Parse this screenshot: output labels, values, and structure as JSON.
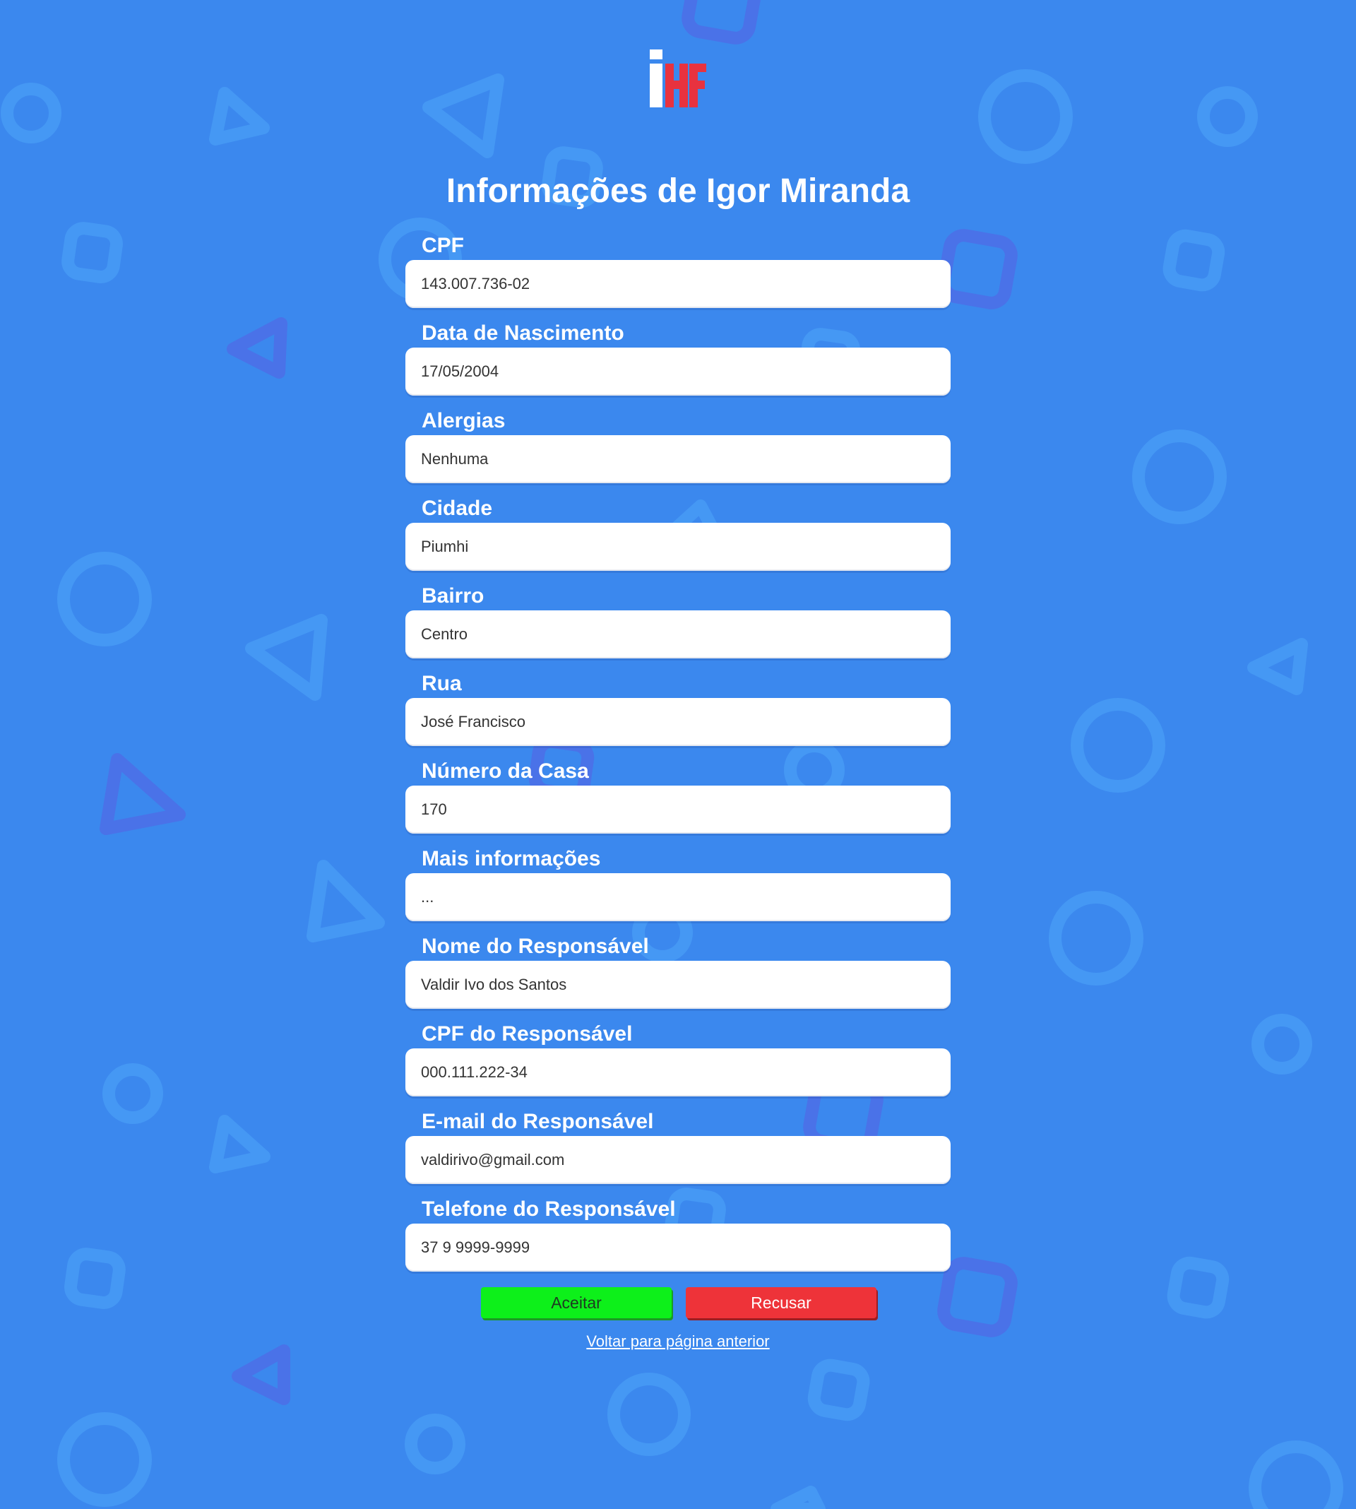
{
  "colors": {
    "background": "#3B88EE",
    "decoration": "#4598F4",
    "decoration_alt": "#4A72E8",
    "accept": "#0DF01A",
    "reject": "#EE3339",
    "logo_white": "#FFFFFF",
    "logo_red": "#E8323F"
  },
  "logo": {
    "letters": "iHF"
  },
  "page": {
    "title": "Informações de Igor Miranda"
  },
  "fields": [
    {
      "label": "CPF",
      "value": "143.007.736-02"
    },
    {
      "label": "Data de Nascimento",
      "value": "17/05/2004"
    },
    {
      "label": "Alergias",
      "value": "Nenhuma"
    },
    {
      "label": "Cidade",
      "value": "Piumhi"
    },
    {
      "label": "Bairro",
      "value": "Centro"
    },
    {
      "label": "Rua",
      "value": "José Francisco"
    },
    {
      "label": "Número da Casa",
      "value": "170"
    },
    {
      "label": "Mais informações",
      "value": "..."
    },
    {
      "label": "Nome do Responsável",
      "value": "Valdir Ivo dos Santos"
    },
    {
      "label": "CPF do Responsável",
      "value": "000.111.222-34"
    },
    {
      "label": "E-mail do Responsável",
      "value": "valdirivo@gmail.com"
    },
    {
      "label": "Telefone do Responsável",
      "value": "37 9 9999-9999"
    }
  ],
  "actions": {
    "accept_label": "Aceitar",
    "reject_label": "Recusar",
    "back_link": "Voltar para página anterior"
  }
}
